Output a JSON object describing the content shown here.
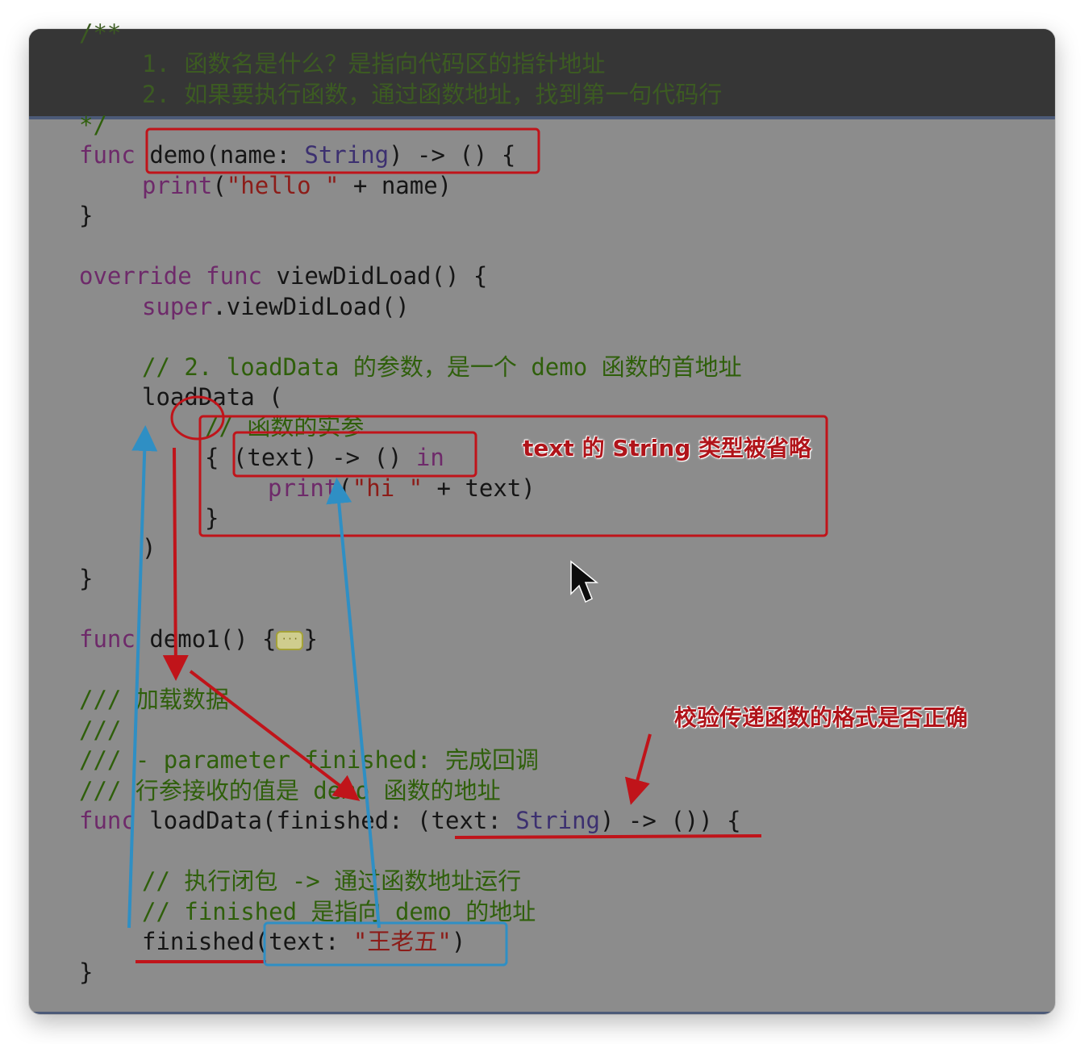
{
  "code": {
    "top_open": "/**",
    "top_line1": "1. 函数名是什么？是指向代码区的指针地址",
    "top_line2": "2. 如果要执行函数，通过函数地址，找到第一句代码行",
    "top_close": "*/",
    "func_kw": "func",
    "demo_sig_a": "demo(name: ",
    "demo_sig_type": "String",
    "demo_sig_b": ") -> ()",
    "open_brace": " {",
    "print_kw": "print",
    "print_open": "(",
    "hello_str": "\"hello \"",
    "print_rest": " + name)",
    "close_brace": "}",
    "override_kw": "override",
    "vdl_sig": " viewDidLoad() {",
    "super_kw": "super",
    "super_call": ".viewDidLoad()",
    "comment_loaddata": "// 2. loadData 的参数，是一个 demo 函数的首地址",
    "loaddata_call": "loadData (",
    "comment_actual": "// 函数的实参",
    "closure_brace": "{ ",
    "closure_params": "(text) -> () ",
    "in_kw": "in",
    "hi_str": "\"hi \"",
    "print_text_rest": " + text)",
    "paren_close": ")",
    "demo1_sig": "demo1() {",
    "doc_prefix": "///",
    "doc_line1": " 加载数据",
    "doc_line3": " - parameter finished: 完成回调",
    "doc_line4": " 行参接收的值是 demo 函数的地址",
    "loaddata_sig_a": " loadData(finished: (text: ",
    "loaddata_sig_type": "String",
    "loaddata_sig_b": ") -> ()) {",
    "comment_exec": "// 执行闭包 -> 通过函数地址运行",
    "comment_finished": "// finished 是指向 demo 的地址",
    "finished_call_a": "finished(text: ",
    "finished_str": "\"王老五\"",
    "finished_call_b": ")"
  },
  "annotations": {
    "omitted_note": "text 的 String 类型被省略",
    "verify_note": "校验传递函数的格式是否正确"
  },
  "colors": {
    "annotation_red": "#c0141a",
    "annotation_blue": "#2f8fc4",
    "keyword": "#6e2a6a",
    "comment": "#2f5f0b",
    "string": "#8c1c18"
  },
  "icons": {
    "fold": "code-fold-icon",
    "cursor": "mouse-pointer-icon"
  }
}
